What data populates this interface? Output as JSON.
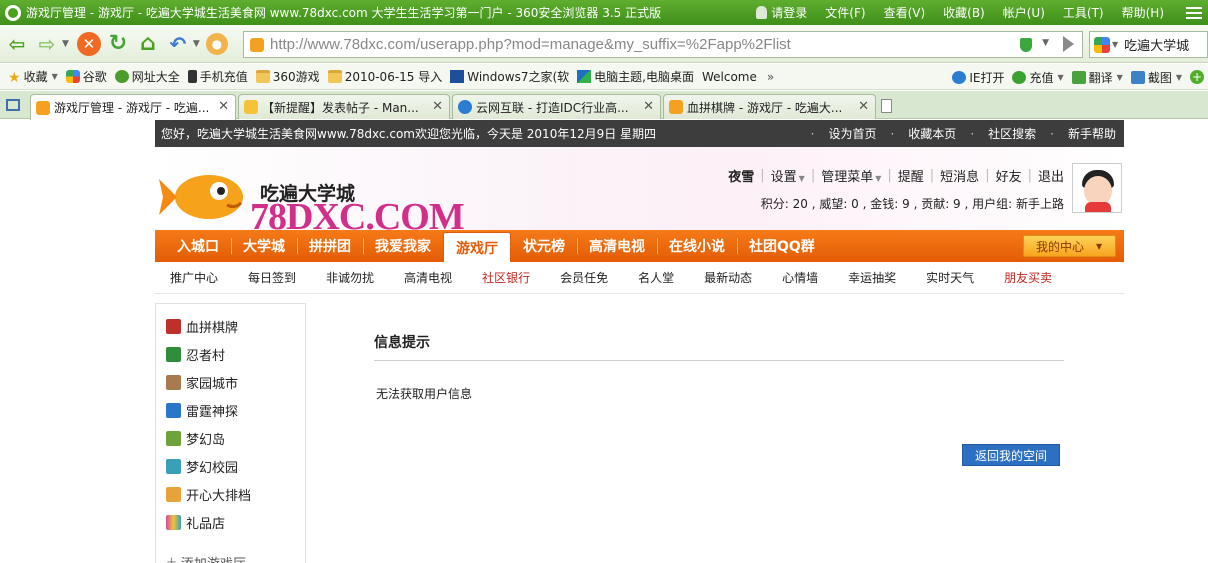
{
  "browser": {
    "window_title": "游戏厅管理 - 游戏厅 - 吃遍大学城生活美食网 www.78dxc.com 大学生生活学习第一门户 - 360安全浏览器 3.5 正式版",
    "menu": [
      "请登录",
      "文件(F)",
      "查看(V)",
      "收藏(B)",
      "帐户(U)",
      "工具(T)",
      "帮助(H)"
    ],
    "url": "http://www.78dxc.com/userapp.php?mod=manage&my_suffix=%2Fapp%2Flist",
    "search_engine_label": "吃遍大学城",
    "bookmarks": [
      {
        "label": "收藏",
        "icon": "star-icon"
      },
      {
        "label": "谷歌",
        "icon": "google-icon"
      },
      {
        "label": "网址大全",
        "icon": "nav-icon"
      },
      {
        "label": "手机充值",
        "icon": "phone-icon"
      },
      {
        "label": "360游戏",
        "icon": "folder-icon"
      },
      {
        "label": "2010-06-15 导入",
        "icon": "folder-icon"
      },
      {
        "label": "Windows7之家(软",
        "icon": "win7-icon"
      },
      {
        "label": "电脑主题,电脑桌面",
        "icon": "theme-icon"
      },
      {
        "label": "Welcome",
        "icon": "page-icon"
      }
    ],
    "bookmarks_more": "»",
    "toolbar_right": [
      {
        "label": "IE打开",
        "icon": "ie-icon"
      },
      {
        "label": "充值",
        "icon": "charge-icon"
      },
      {
        "label": "翻译",
        "icon": "translate-icon"
      },
      {
        "label": "截图",
        "icon": "capture-icon"
      }
    ],
    "tabs": [
      {
        "label": "游戏厅管理 - 游戏厅 - 吃遍...",
        "active": true,
        "color": "#f4a020"
      },
      {
        "label": "【新提醒】发表帖子 - Man...",
        "active": false,
        "color": "#f6c23a"
      },
      {
        "label": "云网互联 - 打造IDC行业高...",
        "active": false,
        "color": "#2b7cd3"
      },
      {
        "label": "血拼棋牌 - 游戏厅 - 吃遍大...",
        "active": false,
        "color": "#f4a020"
      }
    ]
  },
  "site": {
    "welcome": "您好，吃遍大学城生活美食网www.78dxc.com欢迎您光临，今天是 2010年12月9日 星期四",
    "top_links": [
      "设为首页",
      "收藏本页",
      "社区搜索",
      "新手帮助"
    ],
    "logo_cn": "吃遍大学城",
    "logo_en": "78DXC.COM",
    "user": {
      "name": "夜雪",
      "menu": [
        "设置",
        "管理菜单",
        "提醒",
        "短消息",
        "好友",
        "退出"
      ],
      "stats": "积分: 20 , 威望: 0 , 金钱: 9 , 贡献: 9 , 用户组: 新手上路"
    },
    "main_nav": [
      "入城口",
      "大学城",
      "拼拼团",
      "我爱我家",
      "游戏厅",
      "状元榜",
      "高清电视",
      "在线小说",
      "社团QQ群"
    ],
    "main_nav_active": "游戏厅",
    "my_center": "我的中心",
    "sub_nav": [
      {
        "label": "推广中心",
        "red": false
      },
      {
        "label": "每日签到",
        "red": false
      },
      {
        "label": "非诚勿扰",
        "red": false
      },
      {
        "label": "高清电视",
        "red": false
      },
      {
        "label": "社区银行",
        "red": true
      },
      {
        "label": "会员任免",
        "red": false
      },
      {
        "label": "名人堂",
        "red": false
      },
      {
        "label": "最新动态",
        "red": false
      },
      {
        "label": "心情墙",
        "red": false
      },
      {
        "label": "幸运抽奖",
        "red": false
      },
      {
        "label": "实时天气",
        "red": false
      },
      {
        "label": "朋友买卖",
        "red": true
      }
    ],
    "games": [
      {
        "label": "血拼棋牌",
        "icon": "chess-icon",
        "color": "#c0302a"
      },
      {
        "label": "忍者村",
        "icon": "ninja-icon",
        "color": "#2f8e3a"
      },
      {
        "label": "家园城市",
        "icon": "city-icon",
        "color": "#a77a4f"
      },
      {
        "label": "雷霆神探",
        "icon": "detective-icon",
        "color": "#2a77c9"
      },
      {
        "label": "梦幻岛",
        "icon": "island-icon",
        "color": "#6ea33a"
      },
      {
        "label": "梦幻校园",
        "icon": "campus-icon",
        "color": "#3aa0b8"
      },
      {
        "label": "开心大排档",
        "icon": "food-stall-icon",
        "color": "#e7a33a"
      },
      {
        "label": "礼品店",
        "icon": "gift-shop-icon",
        "color": "#d24a9c"
      }
    ],
    "add_game": "添加游戏厅",
    "info_title": "信息提示",
    "info_message": "无法获取用户信息",
    "back_button": "返回我的空间"
  }
}
